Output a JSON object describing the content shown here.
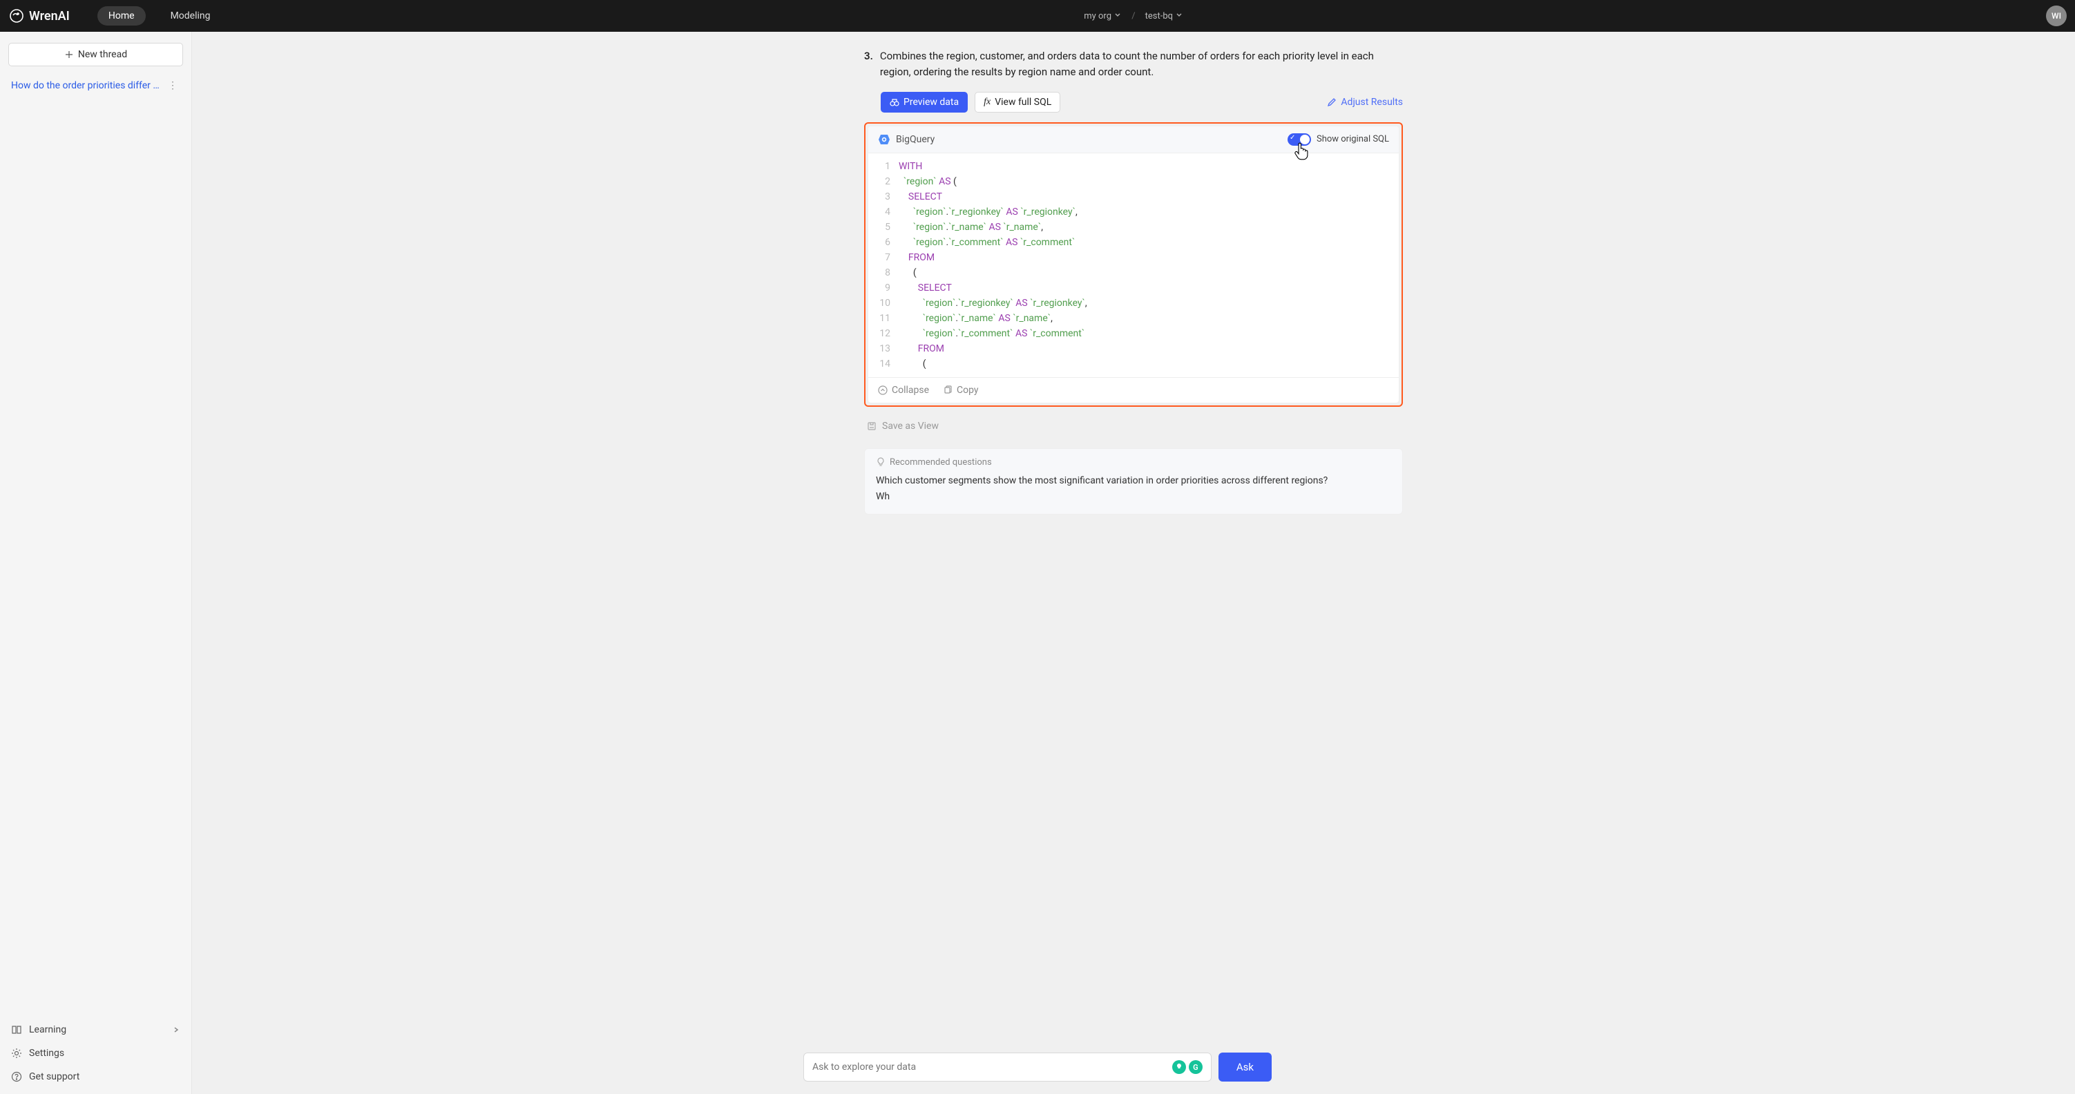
{
  "brand": "WrenAI",
  "nav": {
    "home": "Home",
    "modeling": "Modeling"
  },
  "breadcrumb": {
    "org": "my org",
    "project": "test-bq"
  },
  "avatar_initials": "WI",
  "sidebar": {
    "new_thread": "New thread",
    "threads": [
      {
        "title": "How do the order priorities differ …"
      }
    ],
    "footer": {
      "learning": "Learning",
      "settings": "Settings",
      "support": "Get support"
    }
  },
  "step": {
    "num": "3.",
    "text": "Combines the region, customer, and orders data to count the number of orders for each priority level in each region, ordering the results by region name and order count."
  },
  "actions": {
    "preview": "Preview data",
    "view_full": "View full SQL",
    "adjust": "Adjust Results"
  },
  "sql_head": {
    "engine": "BigQuery",
    "toggle_label": "Show original SQL"
  },
  "code_lines": [
    [
      {
        "t": "WITH",
        "c": "kw"
      }
    ],
    [
      {
        "t": "  ",
        "c": "punc"
      },
      {
        "t": "`region`",
        "c": "name"
      },
      {
        "t": " ",
        "c": "punc"
      },
      {
        "t": "AS",
        "c": "kw"
      },
      {
        "t": " (",
        "c": "punc"
      }
    ],
    [
      {
        "t": "    ",
        "c": "punc"
      },
      {
        "t": "SELECT",
        "c": "kw"
      }
    ],
    [
      {
        "t": "      ",
        "c": "punc"
      },
      {
        "t": "`region`",
        "c": "name"
      },
      {
        "t": ".",
        "c": "punc"
      },
      {
        "t": "`r_regionkey`",
        "c": "name"
      },
      {
        "t": " ",
        "c": "punc"
      },
      {
        "t": "AS",
        "c": "kw"
      },
      {
        "t": " ",
        "c": "punc"
      },
      {
        "t": "`r_regionkey`",
        "c": "name"
      },
      {
        "t": ",",
        "c": "punc"
      }
    ],
    [
      {
        "t": "      ",
        "c": "punc"
      },
      {
        "t": "`region`",
        "c": "name"
      },
      {
        "t": ".",
        "c": "punc"
      },
      {
        "t": "`r_name`",
        "c": "name"
      },
      {
        "t": " ",
        "c": "punc"
      },
      {
        "t": "AS",
        "c": "kw"
      },
      {
        "t": " ",
        "c": "punc"
      },
      {
        "t": "`r_name`",
        "c": "name"
      },
      {
        "t": ",",
        "c": "punc"
      }
    ],
    [
      {
        "t": "      ",
        "c": "punc"
      },
      {
        "t": "`region`",
        "c": "name"
      },
      {
        "t": ".",
        "c": "punc"
      },
      {
        "t": "`r_comment`",
        "c": "name"
      },
      {
        "t": " ",
        "c": "punc"
      },
      {
        "t": "AS",
        "c": "kw"
      },
      {
        "t": " ",
        "c": "punc"
      },
      {
        "t": "`r_comment`",
        "c": "name"
      }
    ],
    [
      {
        "t": "    ",
        "c": "punc"
      },
      {
        "t": "FROM",
        "c": "kw"
      }
    ],
    [
      {
        "t": "      (",
        "c": "punc"
      }
    ],
    [
      {
        "t": "        ",
        "c": "punc"
      },
      {
        "t": "SELECT",
        "c": "kw"
      }
    ],
    [
      {
        "t": "          ",
        "c": "punc"
      },
      {
        "t": "`region`",
        "c": "name"
      },
      {
        "t": ".",
        "c": "punc"
      },
      {
        "t": "`r_regionkey`",
        "c": "name"
      },
      {
        "t": " ",
        "c": "punc"
      },
      {
        "t": "AS",
        "c": "kw"
      },
      {
        "t": " ",
        "c": "punc"
      },
      {
        "t": "`r_regionkey`",
        "c": "name"
      },
      {
        "t": ",",
        "c": "punc"
      }
    ],
    [
      {
        "t": "          ",
        "c": "punc"
      },
      {
        "t": "`region`",
        "c": "name"
      },
      {
        "t": ".",
        "c": "punc"
      },
      {
        "t": "`r_name`",
        "c": "name"
      },
      {
        "t": " ",
        "c": "punc"
      },
      {
        "t": "AS",
        "c": "kw"
      },
      {
        "t": " ",
        "c": "punc"
      },
      {
        "t": "`r_name`",
        "c": "name"
      },
      {
        "t": ",",
        "c": "punc"
      }
    ],
    [
      {
        "t": "          ",
        "c": "punc"
      },
      {
        "t": "`region`",
        "c": "name"
      },
      {
        "t": ".",
        "c": "punc"
      },
      {
        "t": "`r_comment`",
        "c": "name"
      },
      {
        "t": " ",
        "c": "punc"
      },
      {
        "t": "AS",
        "c": "kw"
      },
      {
        "t": " ",
        "c": "punc"
      },
      {
        "t": "`r_comment`",
        "c": "name"
      }
    ],
    [
      {
        "t": "        ",
        "c": "punc"
      },
      {
        "t": "FROM",
        "c": "kw"
      }
    ],
    [
      {
        "t": "          (",
        "c": "punc"
      }
    ]
  ],
  "sql_foot": {
    "collapse": "Collapse",
    "copy": "Copy"
  },
  "save_view": "Save as View",
  "rec": {
    "head": "Recommended questions",
    "q1": "Which customer segments show the most significant variation in order priorities across different regions?",
    "q2_prefix": "Wh"
  },
  "ask": {
    "placeholder": "Ask to explore your data",
    "button": "Ask"
  }
}
